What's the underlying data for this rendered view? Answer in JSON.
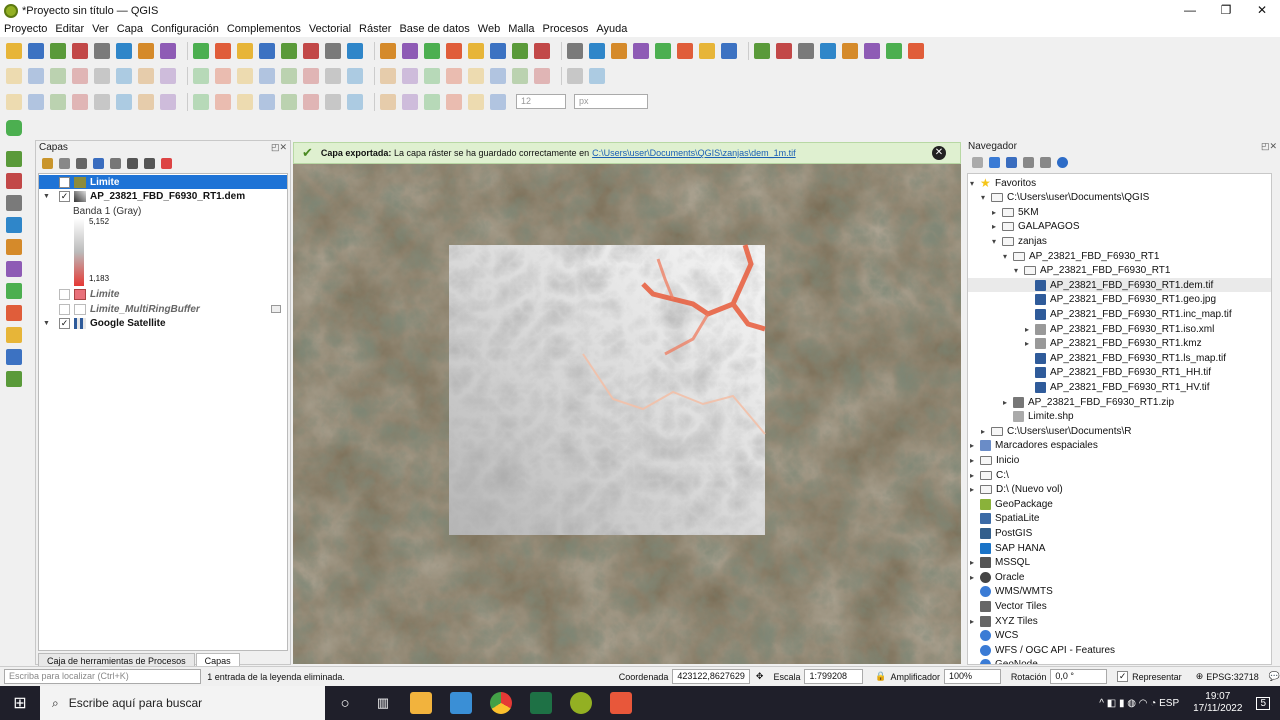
{
  "window": {
    "title": "*Proyecto sin título — QGIS",
    "controls": [
      "—",
      "❐",
      "✕"
    ]
  },
  "menu": [
    "Proyecto",
    "Editar",
    "Ver",
    "Capa",
    "Configuración",
    "Complementos",
    "Vectorial",
    "Ráster",
    "Base de datos",
    "Web",
    "Malla",
    "Procesos",
    "Ayuda"
  ],
  "toolbar": {
    "font_size": "12",
    "unit": "px"
  },
  "layers_panel": {
    "title": "Capas",
    "tabs": [
      "Caja de herramientas de Procesos",
      "Capas"
    ],
    "layers": [
      {
        "name": "Limite",
        "checked": true,
        "selected": true,
        "color": "#8b8b3c"
      },
      {
        "name": "AP_23821_FBD_F6930_RT1.dem",
        "checked": true,
        "band": "Banda 1 (Gray)",
        "max": "5,152",
        "min": "1,183"
      },
      {
        "name": "Limite",
        "checked": false,
        "italic": true,
        "color": "#e9707a"
      },
      {
        "name": "Limite_MultiRingBuffer",
        "checked": false,
        "italic": true
      },
      {
        "name": "Google Satellite",
        "checked": true
      }
    ]
  },
  "message": {
    "label": "Capa exportada:",
    "text": "La capa ráster se ha guardado correctamente en",
    "link": "C:\\Users\\user\\Documents\\QGIS\\zanjas\\dem_1m.tif",
    "close": "✕"
  },
  "navigator": {
    "title": "Navegador",
    "items": [
      {
        "t": "Favoritos",
        "lv": 0,
        "a": "▾",
        "k": "star"
      },
      {
        "t": "C:\\Users\\user\\Documents\\QGIS",
        "lv": 1,
        "a": "▾",
        "k": "folder"
      },
      {
        "t": "5KM",
        "lv": 2,
        "a": "▸",
        "k": "folder"
      },
      {
        "t": "GALAPAGOS",
        "lv": 2,
        "a": "▸",
        "k": "folder"
      },
      {
        "t": "zanjas",
        "lv": 2,
        "a": "▾",
        "k": "folder"
      },
      {
        "t": "AP_23821_FBD_F6930_RT1",
        "lv": 3,
        "a": "▾",
        "k": "folder"
      },
      {
        "t": "AP_23821_FBD_F6930_RT1",
        "lv": 4,
        "a": "▾",
        "k": "folder"
      },
      {
        "t": "AP_23821_FBD_F6930_RT1.dem.tif",
        "lv": 5,
        "a": "",
        "k": "raster",
        "sel": true
      },
      {
        "t": "AP_23821_FBD_F6930_RT1.geo.jpg",
        "lv": 5,
        "a": "",
        "k": "raster"
      },
      {
        "t": "AP_23821_FBD_F6930_RT1.inc_map.tif",
        "lv": 5,
        "a": "",
        "k": "raster"
      },
      {
        "t": "AP_23821_FBD_F6930_RT1.iso.xml",
        "lv": 5,
        "a": "▸",
        "k": "db"
      },
      {
        "t": "AP_23821_FBD_F6930_RT1.kmz",
        "lv": 5,
        "a": "▸",
        "k": "db"
      },
      {
        "t": "AP_23821_FBD_F6930_RT1.ls_map.tif",
        "lv": 5,
        "a": "",
        "k": "raster"
      },
      {
        "t": "AP_23821_FBD_F6930_RT1_HH.tif",
        "lv": 5,
        "a": "",
        "k": "raster"
      },
      {
        "t": "AP_23821_FBD_F6930_RT1_HV.tif",
        "lv": 5,
        "a": "",
        "k": "raster"
      },
      {
        "t": "AP_23821_FBD_F6930_RT1.zip",
        "lv": 3,
        "a": "▸",
        "k": "zip"
      },
      {
        "t": "Limite.shp",
        "lv": 3,
        "a": "",
        "k": "shp"
      },
      {
        "t": "C:\\Users\\user\\Documents\\R",
        "lv": 1,
        "a": "▸",
        "k": "folder"
      },
      {
        "t": "Marcadores espaciales",
        "lv": 0,
        "a": "▸",
        "k": "bookmark"
      },
      {
        "t": "Inicio",
        "lv": 0,
        "a": "▸",
        "k": "folder"
      },
      {
        "t": "C:\\",
        "lv": 0,
        "a": "▸",
        "k": "folder"
      },
      {
        "t": "D:\\ (Nuevo vol)",
        "lv": 0,
        "a": "▸",
        "k": "folder"
      },
      {
        "t": "GeoPackage",
        "lv": 0,
        "a": "",
        "k": "gpkg"
      },
      {
        "t": "SpatiaLite",
        "lv": 0,
        "a": "",
        "k": "spatialite"
      },
      {
        "t": "PostGIS",
        "lv": 0,
        "a": "",
        "k": "postgis"
      },
      {
        "t": "SAP HANA",
        "lv": 0,
        "a": "",
        "k": "hana"
      },
      {
        "t": "MSSQL",
        "lv": 0,
        "a": "▸",
        "k": "mssql"
      },
      {
        "t": "Oracle",
        "lv": 0,
        "a": "▸",
        "k": "oracle"
      },
      {
        "t": "WMS/WMTS",
        "lv": 0,
        "a": "",
        "k": "wms"
      },
      {
        "t": "Vector Tiles",
        "lv": 0,
        "a": "",
        "k": "tiles"
      },
      {
        "t": "XYZ Tiles",
        "lv": 0,
        "a": "▸",
        "k": "tiles"
      },
      {
        "t": "WCS",
        "lv": 0,
        "a": "",
        "k": "wms"
      },
      {
        "t": "WFS / OGC API - Features",
        "lv": 0,
        "a": "",
        "k": "wms"
      },
      {
        "t": "GeoNode",
        "lv": 0,
        "a": "",
        "k": "wms"
      }
    ]
  },
  "status": {
    "locator_placeholder": "Escriba para localizar (Ctrl+K)",
    "message": "1 entrada de la leyenda eliminada.",
    "coord_label": "Coordenada",
    "coord": "423122,8627629",
    "scale_label": "Escala",
    "scale": "1:799208",
    "mag_label": "Amplificador",
    "mag": "100%",
    "rot_label": "Rotación",
    "rot": "0,0 °",
    "render": "Representar",
    "crs": "EPSG:32718"
  },
  "taskbar": {
    "search": "Escribe aquí para buscar",
    "time": "19:07",
    "date": "17/11/2022",
    "notif": "5"
  }
}
